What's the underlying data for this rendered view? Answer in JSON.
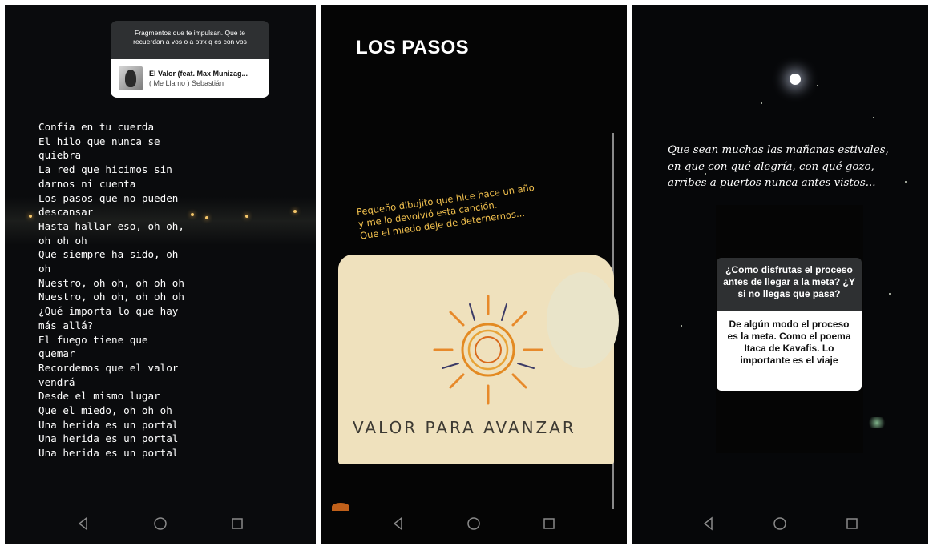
{
  "panel1": {
    "music_sticker": {
      "question": "Fragmentos que te impulsan. Que te recuerdan a vos o a otrx q es con vos",
      "track_title": "El Valor (feat. Max Munizag...",
      "track_artist": "( Me Llamo ) Sebastián"
    },
    "lyrics": [
      "Confía en tu cuerda",
      "El hilo que nunca se",
      "quiebra",
      "La red que hicimos sin",
      "darnos ni cuenta",
      "Los pasos que no pueden",
      "descansar",
      "Hasta hallar eso, oh oh,",
      "oh oh oh",
      "Que siempre ha sido, oh",
      "oh",
      "Nuestro, oh oh, oh oh oh",
      "Nuestro, oh oh, oh oh oh",
      "¿Qué importa lo que hay",
      "más allá?",
      "El fuego tiene que",
      "quemar",
      "Recordemos que el valor",
      "vendrá",
      "Desde el mismo lugar",
      "Que el miedo, oh oh oh",
      "Una herida es un portal",
      "Una herida es un portal",
      "Una herida es un portal"
    ]
  },
  "panel2": {
    "title": "LOS PASOS",
    "caption": [
      "Pequeño dibujito que hice hace un año",
      "y me lo devolvió esta canción.",
      "Que el miedo deje de deternernos..."
    ],
    "drawing_text": "VALOR PARA AVANZAR"
  },
  "panel3": {
    "quote": [
      "Que sean muchas las mañanas estivales,",
      "en que con qué alegría, con qué gozo,",
      "arribes a puertos nunca antes vistos..."
    ],
    "question": "¿Como disfrutas el proceso antes de llegar a la meta? ¿Y si no llegas que pasa?",
    "answer": "De algún modo el proceso es la meta. Como el poema Itaca de Kavafis. Lo importante es el viaje"
  },
  "navbar": {
    "icons": [
      "back-triangle-icon",
      "home-circle-icon",
      "recents-square-icon"
    ],
    "color": "#8a8a8a"
  },
  "colors": {
    "caption_yellow": "#f2c14e",
    "card_dark": "#2e3032"
  }
}
